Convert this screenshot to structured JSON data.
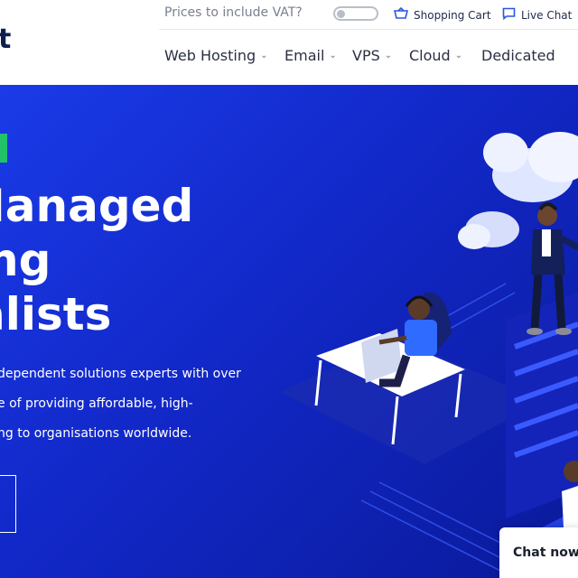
{
  "header": {
    "logo_fragment": "t",
    "vat_label": "Prices to include VAT?",
    "cart_label": "Shopping Cart",
    "chat_label": "Live Chat"
  },
  "nav": {
    "items": [
      {
        "label": "Web Hosting"
      },
      {
        "label": "Email"
      },
      {
        "label": "VPS"
      },
      {
        "label": "Cloud"
      },
      {
        "label": "Dedicated"
      }
    ]
  },
  "hero": {
    "headline": [
      "Managed",
      "ng",
      "alists"
    ],
    "description": [
      "dependent solutions experts with over",
      "e of providing affordable, high-",
      "ng to organisations worldwide."
    ]
  },
  "chat_widget": {
    "label": "Chat now"
  },
  "colors": {
    "hero_blue": "#1a3be8",
    "accent_green": "#23c16a"
  },
  "icons": {
    "cart": "basket-icon",
    "chat": "chat-bubble-icon",
    "dropdown": "chevron-down-icon"
  }
}
